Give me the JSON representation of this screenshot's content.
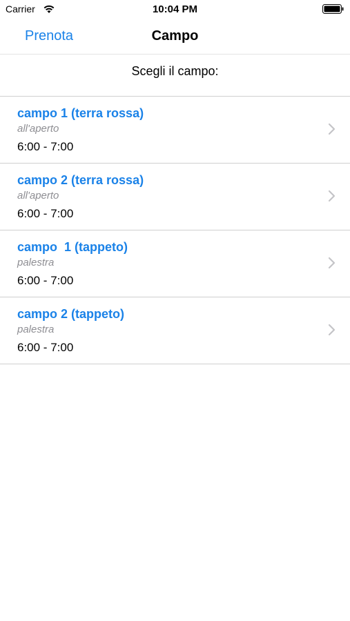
{
  "status_bar": {
    "carrier": "Carrier",
    "time": "10:04 PM",
    "icons": [
      "wifi-icon",
      "battery-icon"
    ]
  },
  "nav": {
    "back_label": "Prenota",
    "title": "Campo"
  },
  "section": {
    "header": "Scegli il campo:"
  },
  "courts": [
    {
      "name": "campo 1 (terra rossa)",
      "type": "all'aperto",
      "time": "6:00 - 7:00"
    },
    {
      "name": "campo 2 (terra rossa)",
      "type": "all'aperto",
      "time": "6:00 - 7:00"
    },
    {
      "name": "campo  1 (tappeto)",
      "type": "palestra",
      "time": "6:00 - 7:00"
    },
    {
      "name": "campo 2 (tappeto)",
      "type": "palestra",
      "time": "6:00 - 7:00"
    }
  ],
  "colors": {
    "accent": "#1a82e8",
    "subtitle": "#8e8e93",
    "separator": "#cfcfcf"
  }
}
